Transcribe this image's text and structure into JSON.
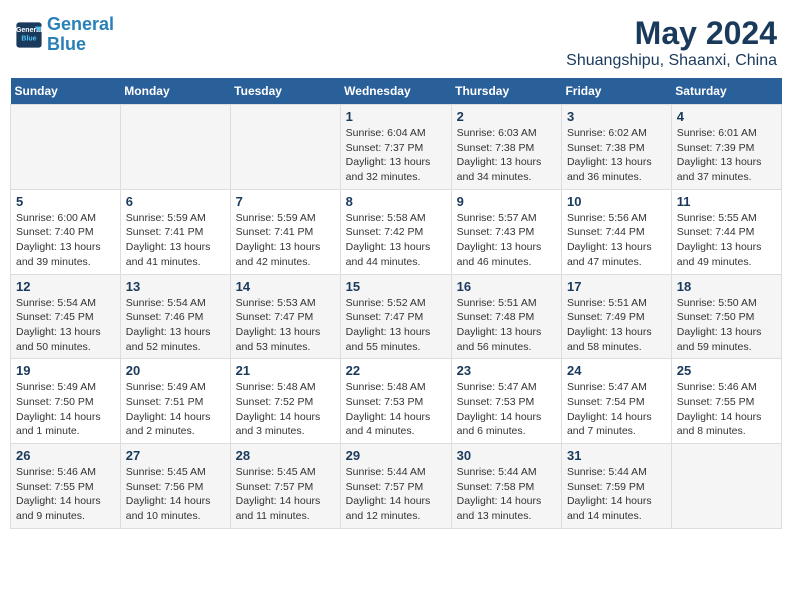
{
  "header": {
    "logo_line1": "General",
    "logo_line2": "Blue",
    "main_title": "May 2024",
    "subtitle": "Shuangshipu, Shaanxi, China"
  },
  "calendar": {
    "days_of_week": [
      "Sunday",
      "Monday",
      "Tuesday",
      "Wednesday",
      "Thursday",
      "Friday",
      "Saturday"
    ],
    "weeks": [
      [
        {
          "day": "",
          "info": ""
        },
        {
          "day": "",
          "info": ""
        },
        {
          "day": "",
          "info": ""
        },
        {
          "day": "1",
          "info": "Sunrise: 6:04 AM\nSunset: 7:37 PM\nDaylight: 13 hours\nand 32 minutes."
        },
        {
          "day": "2",
          "info": "Sunrise: 6:03 AM\nSunset: 7:38 PM\nDaylight: 13 hours\nand 34 minutes."
        },
        {
          "day": "3",
          "info": "Sunrise: 6:02 AM\nSunset: 7:38 PM\nDaylight: 13 hours\nand 36 minutes."
        },
        {
          "day": "4",
          "info": "Sunrise: 6:01 AM\nSunset: 7:39 PM\nDaylight: 13 hours\nand 37 minutes."
        }
      ],
      [
        {
          "day": "5",
          "info": "Sunrise: 6:00 AM\nSunset: 7:40 PM\nDaylight: 13 hours\nand 39 minutes."
        },
        {
          "day": "6",
          "info": "Sunrise: 5:59 AM\nSunset: 7:41 PM\nDaylight: 13 hours\nand 41 minutes."
        },
        {
          "day": "7",
          "info": "Sunrise: 5:59 AM\nSunset: 7:41 PM\nDaylight: 13 hours\nand 42 minutes."
        },
        {
          "day": "8",
          "info": "Sunrise: 5:58 AM\nSunset: 7:42 PM\nDaylight: 13 hours\nand 44 minutes."
        },
        {
          "day": "9",
          "info": "Sunrise: 5:57 AM\nSunset: 7:43 PM\nDaylight: 13 hours\nand 46 minutes."
        },
        {
          "day": "10",
          "info": "Sunrise: 5:56 AM\nSunset: 7:44 PM\nDaylight: 13 hours\nand 47 minutes."
        },
        {
          "day": "11",
          "info": "Sunrise: 5:55 AM\nSunset: 7:44 PM\nDaylight: 13 hours\nand 49 minutes."
        }
      ],
      [
        {
          "day": "12",
          "info": "Sunrise: 5:54 AM\nSunset: 7:45 PM\nDaylight: 13 hours\nand 50 minutes."
        },
        {
          "day": "13",
          "info": "Sunrise: 5:54 AM\nSunset: 7:46 PM\nDaylight: 13 hours\nand 52 minutes."
        },
        {
          "day": "14",
          "info": "Sunrise: 5:53 AM\nSunset: 7:47 PM\nDaylight: 13 hours\nand 53 minutes."
        },
        {
          "day": "15",
          "info": "Sunrise: 5:52 AM\nSunset: 7:47 PM\nDaylight: 13 hours\nand 55 minutes."
        },
        {
          "day": "16",
          "info": "Sunrise: 5:51 AM\nSunset: 7:48 PM\nDaylight: 13 hours\nand 56 minutes."
        },
        {
          "day": "17",
          "info": "Sunrise: 5:51 AM\nSunset: 7:49 PM\nDaylight: 13 hours\nand 58 minutes."
        },
        {
          "day": "18",
          "info": "Sunrise: 5:50 AM\nSunset: 7:50 PM\nDaylight: 13 hours\nand 59 minutes."
        }
      ],
      [
        {
          "day": "19",
          "info": "Sunrise: 5:49 AM\nSunset: 7:50 PM\nDaylight: 14 hours\nand 1 minute."
        },
        {
          "day": "20",
          "info": "Sunrise: 5:49 AM\nSunset: 7:51 PM\nDaylight: 14 hours\nand 2 minutes."
        },
        {
          "day": "21",
          "info": "Sunrise: 5:48 AM\nSunset: 7:52 PM\nDaylight: 14 hours\nand 3 minutes."
        },
        {
          "day": "22",
          "info": "Sunrise: 5:48 AM\nSunset: 7:53 PM\nDaylight: 14 hours\nand 4 minutes."
        },
        {
          "day": "23",
          "info": "Sunrise: 5:47 AM\nSunset: 7:53 PM\nDaylight: 14 hours\nand 6 minutes."
        },
        {
          "day": "24",
          "info": "Sunrise: 5:47 AM\nSunset: 7:54 PM\nDaylight: 14 hours\nand 7 minutes."
        },
        {
          "day": "25",
          "info": "Sunrise: 5:46 AM\nSunset: 7:55 PM\nDaylight: 14 hours\nand 8 minutes."
        }
      ],
      [
        {
          "day": "26",
          "info": "Sunrise: 5:46 AM\nSunset: 7:55 PM\nDaylight: 14 hours\nand 9 minutes."
        },
        {
          "day": "27",
          "info": "Sunrise: 5:45 AM\nSunset: 7:56 PM\nDaylight: 14 hours\nand 10 minutes."
        },
        {
          "day": "28",
          "info": "Sunrise: 5:45 AM\nSunset: 7:57 PM\nDaylight: 14 hours\nand 11 minutes."
        },
        {
          "day": "29",
          "info": "Sunrise: 5:44 AM\nSunset: 7:57 PM\nDaylight: 14 hours\nand 12 minutes."
        },
        {
          "day": "30",
          "info": "Sunrise: 5:44 AM\nSunset: 7:58 PM\nDaylight: 14 hours\nand 13 minutes."
        },
        {
          "day": "31",
          "info": "Sunrise: 5:44 AM\nSunset: 7:59 PM\nDaylight: 14 hours\nand 14 minutes."
        },
        {
          "day": "",
          "info": ""
        }
      ]
    ]
  }
}
